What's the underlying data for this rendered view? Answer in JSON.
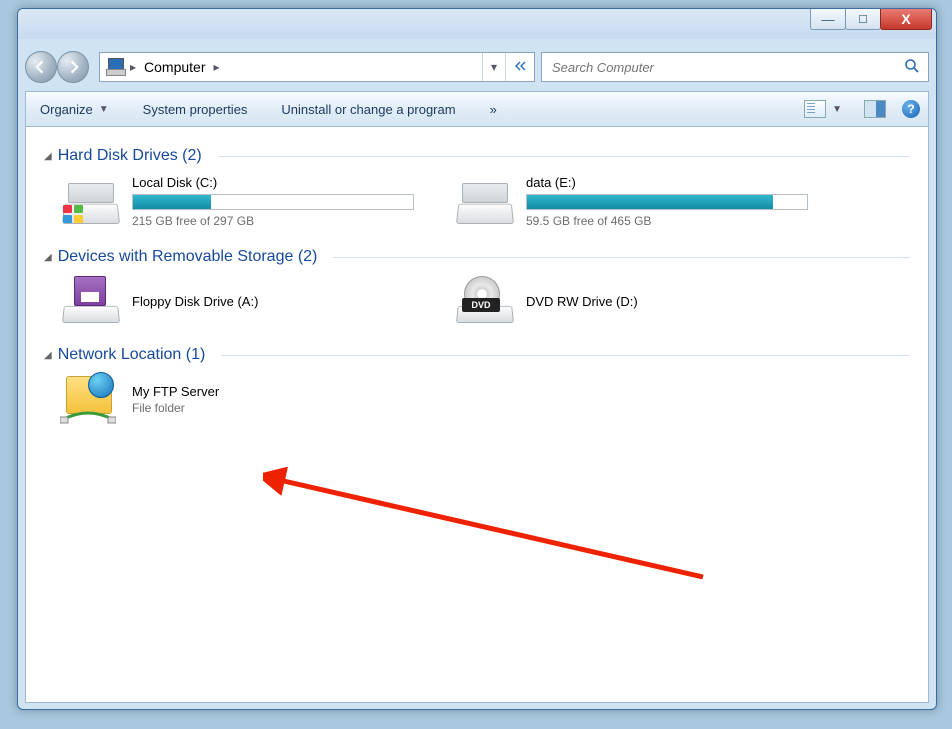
{
  "titlebar": {
    "min": "—",
    "max": "☐",
    "close": "X"
  },
  "breadcrumb": {
    "root": "Computer"
  },
  "search": {
    "placeholder": "Search Computer"
  },
  "toolbar": {
    "organize": "Organize",
    "sysprops": "System properties",
    "uninstall": "Uninstall or change a program",
    "overflow": "»",
    "help": "?"
  },
  "groups": {
    "hdd": {
      "title": "Hard Disk Drives (2)"
    },
    "removable": {
      "title": "Devices with Removable Storage (2)"
    },
    "network": {
      "title": "Network Location (1)"
    }
  },
  "drives": {
    "c": {
      "name": "Local Disk (C:)",
      "sub": "215 GB free of 297 GB",
      "fillPct": 28
    },
    "e": {
      "name": "data (E:)",
      "sub": "59.5 GB free of 465 GB",
      "fillPct": 88
    },
    "a": {
      "name": "Floppy Disk Drive (A:)"
    },
    "d": {
      "name": "DVD RW Drive (D:)"
    },
    "ftp": {
      "name": "My FTP Server",
      "sub": "File folder"
    }
  }
}
